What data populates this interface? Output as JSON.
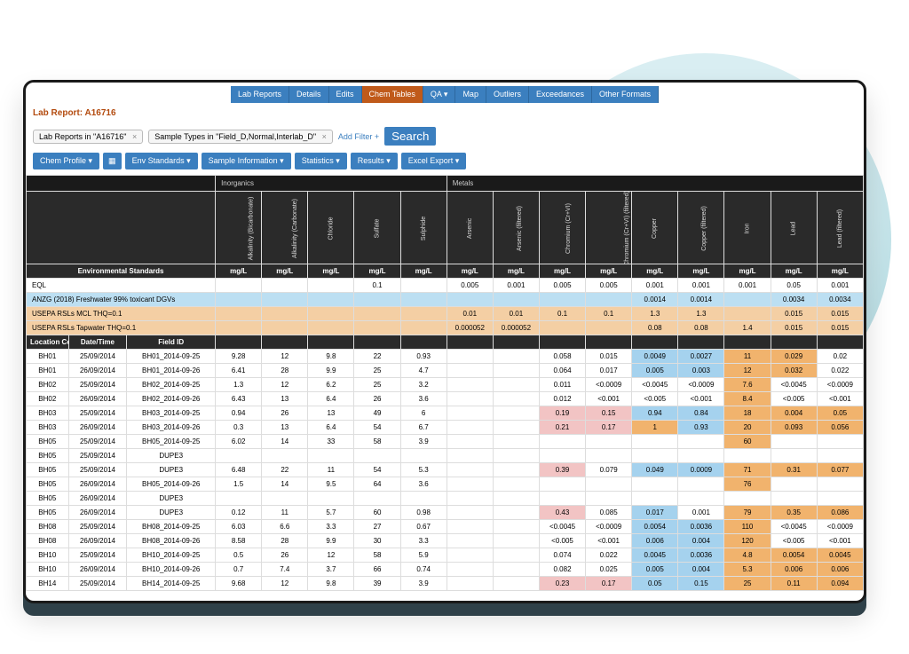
{
  "nav": {
    "items": [
      "Lab Reports",
      "Details",
      "Edits",
      "Chem Tables",
      "QA ▾",
      "Map",
      "Outliers",
      "Exceedances",
      "Other Formats"
    ],
    "active_index": 3
  },
  "report_label": "Lab Report: A16716",
  "filters": {
    "chip1": {
      "label": "Lab Reports in \"A16716\""
    },
    "chip2": {
      "label": "Sample Types in \"Field_D,Normal,Interlab_D\""
    },
    "add_filter": "Add Filter +",
    "search": "Search"
  },
  "toolbar": {
    "chem_profile": "Chem Profile ▾",
    "env_standards": "Env Standards ▾",
    "sample_info": "Sample Information ▾",
    "statistics": "Statistics ▾",
    "results": "Results ▾",
    "excel_export": "Excel Export ▾"
  },
  "categories": [
    {
      "name": "Inorganics",
      "span": 5
    },
    {
      "name": "Metals",
      "span": 9
    }
  ],
  "columns": [
    "Alkalinity (Bicarbonate)",
    "Alkalinity (Carbonate)",
    "Chloride",
    "Sulfate",
    "Sulphide",
    "Arsenic",
    "Arsenic (filtered)",
    "Chromium (Cr+VI)",
    "Chromium (Cr+VI) (filtered)",
    "Copper",
    "Copper (filtered)",
    "Iron",
    "Lead",
    "Lead (filtered)"
  ],
  "env_header": "Environmental Standards",
  "unit": "mg/L",
  "standards": [
    {
      "name": "EQL",
      "cls": "std-eql",
      "vals": [
        "",
        "",
        "",
        "0.1",
        "",
        "0.005",
        "0.001",
        "0.005",
        "0.005",
        "0.001",
        "0.001",
        "0.001",
        "0.05",
        "0.001",
        "0.001"
      ]
    },
    {
      "name": "ANZG (2018) Freshwater 99% toxicant DGVs",
      "cls": "std-anzg",
      "vals": [
        "",
        "",
        "",
        "",
        "",
        "",
        "",
        "",
        "",
        "0.0014",
        "0.0014",
        "",
        "0.0034",
        "0.0034"
      ]
    },
    {
      "name": "USEPA RSLs MCL THQ=0.1",
      "cls": "std-mcl",
      "vals": [
        "",
        "",
        "",
        "",
        "",
        "0.01",
        "0.01",
        "0.1",
        "0.1",
        "1.3",
        "1.3",
        "",
        "0.015",
        "0.015"
      ]
    },
    {
      "name": "USEPA RSLs Tapwater THQ=0.1",
      "cls": "std-tap",
      "vals": [
        "",
        "",
        "",
        "",
        "",
        "0.000052",
        "0.000052",
        "",
        "",
        "0.08",
        "0.08",
        "1.4",
        "0.015",
        "0.015"
      ]
    }
  ],
  "data_head": [
    "Location Code",
    "Date/Time",
    "Field ID"
  ],
  "rows": [
    {
      "loc": "BH01",
      "date": "25/09/2014",
      "field": "BH01_2014-09-25",
      "v": [
        "9.28",
        "12",
        "9.8",
        "22",
        "0.93",
        "",
        "",
        "0.058",
        "0.015",
        "0.0049",
        "0.0027",
        "11",
        "0.029",
        "0.02"
      ],
      "hl": {
        "9": "blue",
        "10": "blue",
        "11": "orange",
        "12": "orange"
      }
    },
    {
      "loc": "BH01",
      "date": "26/09/2014",
      "field": "BH01_2014-09-26",
      "v": [
        "6.41",
        "28",
        "9.9",
        "25",
        "4.7",
        "",
        "",
        "0.064",
        "0.017",
        "0.005",
        "0.003",
        "12",
        "0.032",
        "0.022"
      ],
      "hl": {
        "9": "blue",
        "10": "blue",
        "11": "orange",
        "12": "orange"
      }
    },
    {
      "loc": "BH02",
      "date": "25/09/2014",
      "field": "BH02_2014-09-25",
      "v": [
        "1.3",
        "12",
        "6.2",
        "25",
        "3.2",
        "",
        "",
        "0.011",
        "<0.0009",
        "<0.0045",
        "<0.0009",
        "7.6",
        "<0.0045",
        "<0.0009"
      ],
      "hl": {
        "11": "orange"
      }
    },
    {
      "loc": "BH02",
      "date": "26/09/2014",
      "field": "BH02_2014-09-26",
      "v": [
        "6.43",
        "13",
        "6.4",
        "26",
        "3.6",
        "",
        "",
        "0.012",
        "<0.001",
        "<0.005",
        "<0.001",
        "8.4",
        "<0.005",
        "<0.001"
      ],
      "hl": {
        "11": "orange"
      }
    },
    {
      "loc": "BH03",
      "date": "25/09/2014",
      "field": "BH03_2014-09-25",
      "v": [
        "0.94",
        "26",
        "13",
        "49",
        "6",
        "",
        "",
        "0.19",
        "0.15",
        "0.94",
        "0.84",
        "18",
        "0.004",
        "0.05"
      ],
      "hl": {
        "7": "pink",
        "8": "pink",
        "9": "blue",
        "10": "blue",
        "11": "orange",
        "12": "orange",
        "13": "orange"
      }
    },
    {
      "loc": "BH03",
      "date": "26/09/2014",
      "field": "BH03_2014-09-26",
      "v": [
        "0.3",
        "13",
        "6.4",
        "54",
        "6.7",
        "",
        "",
        "0.21",
        "0.17",
        "1",
        "0.93",
        "20",
        "0.093",
        "0.056"
      ],
      "hl": {
        "7": "pink",
        "8": "pink",
        "9": "orange",
        "10": "blue",
        "11": "orange",
        "12": "orange",
        "13": "orange"
      }
    },
    {
      "loc": "BH05",
      "date": "25/09/2014",
      "field": "BH05_2014-09-25",
      "v": [
        "6.02",
        "14",
        "33",
        "58",
        "3.9",
        "",
        "",
        "",
        "",
        "",
        "",
        "60",
        "",
        ""
      ],
      "hl": {
        "11": "orange"
      }
    },
    {
      "loc": "BH05",
      "date": "25/09/2014",
      "field": "DUPE3",
      "v": [
        "",
        "",
        "",
        "",
        "",
        "",
        "",
        "",
        "",
        "",
        "",
        "",
        "",
        ""
      ],
      "hl": {}
    },
    {
      "loc": "BH05",
      "date": "25/09/2014",
      "field": "DUPE3",
      "v": [
        "6.48",
        "22",
        "11",
        "54",
        "5.3",
        "",
        "",
        "0.39",
        "0.079",
        "0.049",
        "0.0009",
        "71",
        "0.31",
        "0.077"
      ],
      "hl": {
        "7": "pink",
        "9": "blue",
        "10": "blue",
        "11": "orange",
        "12": "orange",
        "13": "orange"
      }
    },
    {
      "loc": "BH05",
      "date": "26/09/2014",
      "field": "BH05_2014-09-26",
      "v": [
        "1.5",
        "14",
        "9.5",
        "64",
        "3.6",
        "",
        "",
        "",
        "",
        "",
        "",
        "76",
        "",
        ""
      ],
      "hl": {
        "11": "orange"
      }
    },
    {
      "loc": "BH05",
      "date": "26/09/2014",
      "field": "DUPE3",
      "v": [
        "",
        "",
        "",
        "",
        "",
        "",
        "",
        "",
        "",
        "",
        "",
        "",
        "",
        ""
      ],
      "hl": {}
    },
    {
      "loc": "BH05",
      "date": "26/09/2014",
      "field": "DUPE3",
      "v": [
        "0.12",
        "11",
        "5.7",
        "60",
        "0.98",
        "",
        "",
        "0.43",
        "0.085",
        "0.017",
        "0.001",
        "79",
        "0.35",
        "0.086"
      ],
      "hl": {
        "7": "pink",
        "9": "blue",
        "11": "orange",
        "12": "orange",
        "13": "orange"
      }
    },
    {
      "loc": "BH08",
      "date": "25/09/2014",
      "field": "BH08_2014-09-25",
      "v": [
        "6.03",
        "6.6",
        "3.3",
        "27",
        "0.67",
        "",
        "",
        "<0.0045",
        "<0.0009",
        "0.0054",
        "0.0036",
        "110",
        "<0.0045",
        "<0.0009"
      ],
      "hl": {
        "9": "blue",
        "10": "blue",
        "11": "orange"
      }
    },
    {
      "loc": "BH08",
      "date": "26/09/2014",
      "field": "BH08_2014-09-26",
      "v": [
        "8.58",
        "28",
        "9.9",
        "30",
        "3.3",
        "",
        "",
        "<0.005",
        "<0.001",
        "0.006",
        "0.004",
        "120",
        "<0.005",
        "<0.001"
      ],
      "hl": {
        "9": "blue",
        "10": "blue",
        "11": "orange"
      }
    },
    {
      "loc": "BH10",
      "date": "25/09/2014",
      "field": "BH10_2014-09-25",
      "v": [
        "0.5",
        "26",
        "12",
        "58",
        "5.9",
        "",
        "",
        "0.074",
        "0.022",
        "0.0045",
        "0.0036",
        "4.8",
        "0.0054",
        "0.0045"
      ],
      "hl": {
        "9": "blue",
        "10": "blue",
        "11": "orange",
        "12": "orange",
        "13": "orange"
      }
    },
    {
      "loc": "BH10",
      "date": "26/09/2014",
      "field": "BH10_2014-09-26",
      "v": [
        "0.7",
        "7.4",
        "3.7",
        "66",
        "0.74",
        "",
        "",
        "0.082",
        "0.025",
        "0.005",
        "0.004",
        "5.3",
        "0.006",
        "0.006"
      ],
      "hl": {
        "9": "blue",
        "10": "blue",
        "11": "orange",
        "12": "orange",
        "13": "orange"
      }
    },
    {
      "loc": "BH14",
      "date": "25/09/2014",
      "field": "BH14_2014-09-25",
      "v": [
        "9.68",
        "12",
        "9.8",
        "39",
        "3.9",
        "",
        "",
        "0.23",
        "0.17",
        "0.05",
        "0.15",
        "25",
        "0.11",
        "0.094"
      ],
      "hl": {
        "7": "pink",
        "8": "pink",
        "9": "blue",
        "10": "blue",
        "11": "orange",
        "12": "orange",
        "13": "orange"
      }
    }
  ]
}
